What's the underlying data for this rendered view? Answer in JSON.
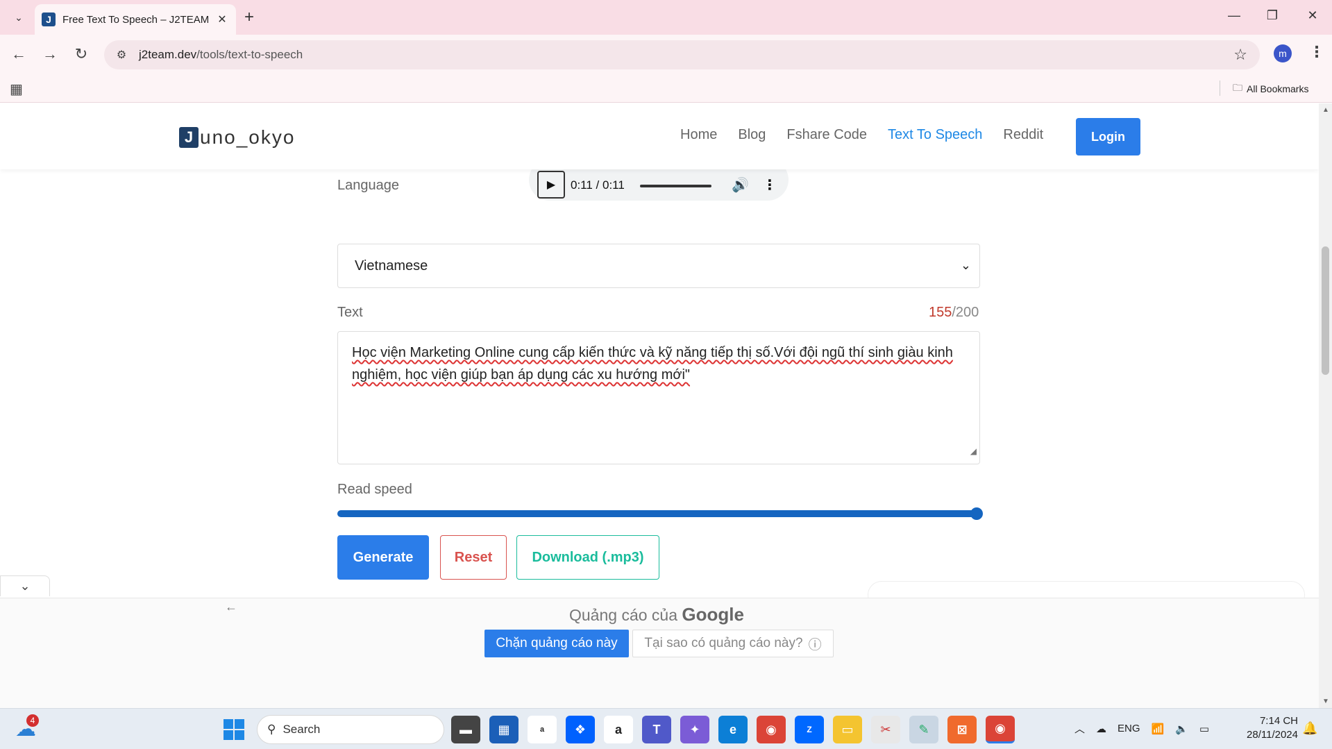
{
  "browser": {
    "tab_title": "Free Text To Speech – J2TEAM",
    "url_domain": "j2team.dev",
    "url_path": "/tools/text-to-speech",
    "bookmarks_label": "All Bookmarks",
    "profile_initial": "m"
  },
  "site": {
    "logo_mark": "J",
    "logo_text": "uno_okyo",
    "nav": [
      "Home",
      "Blog",
      "Fshare Code",
      "Text To Speech",
      "Reddit"
    ],
    "active_nav": "Text To Speech",
    "login_label": "Login"
  },
  "audio": {
    "time": "0:11 / 0:11",
    "progress": 1.0
  },
  "form": {
    "language_label": "Language",
    "language_value": "Vietnamese",
    "text_label": "Text",
    "count_current": "155",
    "count_max": "/200",
    "text_value": "Học viện Marketing Online cung cấp kiến thức và kỹ năng tiếp thị số.Với đội ngũ thí sinh giàu kinh nghiệm, học viện giúp bạn áp dụng các xu hướng mới\"",
    "speed_label": "Read speed",
    "speed_level": 1.0,
    "generate_label": "Generate",
    "reset_label": "Reset",
    "download_label": "Download (.mp3)"
  },
  "ad": {
    "title_prefix": "Quảng cáo của",
    "title_brand": "Google",
    "block_label": "Chặn quảng cáo này",
    "why_label": "Tại sao có quảng cáo này?"
  },
  "taskbar": {
    "search_label": "Search",
    "weather_badge": "4",
    "lang": "ENG",
    "time": "7:14 CH",
    "date": "28/11/2024"
  },
  "colors": {
    "accent": "#2b7de9",
    "nav_active": "#1e88e5",
    "reset": "#d9534f",
    "download": "#1abc9c",
    "counter": "#c0392b",
    "tab_bar": "#f9dde5"
  }
}
